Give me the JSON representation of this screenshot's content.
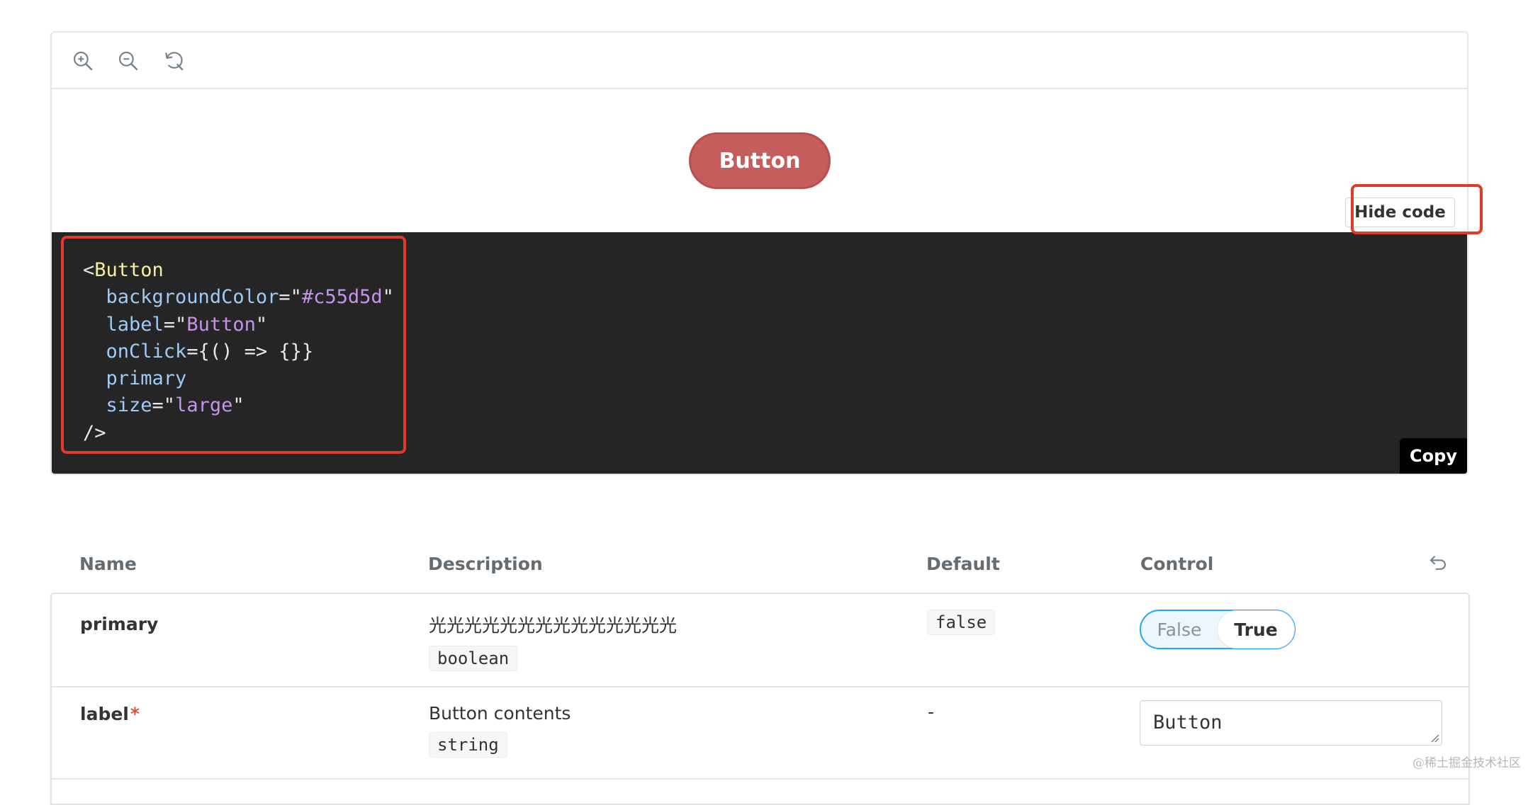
{
  "toolbar": {
    "icons": [
      "zoom-in-icon",
      "zoom-out-icon",
      "reset-zoom-icon"
    ]
  },
  "preview": {
    "button_label": "Button",
    "button_color": "#c55d5d",
    "hide_code_label": "Hide code"
  },
  "code": {
    "lines": [
      {
        "tag": "<Button"
      },
      {
        "attr": "backgroundColor",
        "eq": "=\"",
        "str": "#c55d5d",
        "end": "\""
      },
      {
        "attr": "label",
        "eq": "=\"",
        "str": "Button",
        "end": "\""
      },
      {
        "attr": "onClick",
        "eq": "={() => {}}"
      },
      {
        "attr": "primary"
      },
      {
        "attr": "size",
        "eq": "=\"",
        "str": "large",
        "end": "\""
      },
      {
        "tag": "/>"
      }
    ],
    "copy_label": "Copy"
  },
  "highlight_color": "#e03a2c",
  "table": {
    "headers": {
      "name": "Name",
      "description": "Description",
      "default": "Default",
      "control": "Control"
    },
    "rows": [
      {
        "name": "primary",
        "required": false,
        "description": "光光光光光光光光光光光光光光",
        "type": "boolean",
        "default": "false",
        "control": {
          "type": "toggle",
          "options": [
            "False",
            "True"
          ],
          "selected": "True"
        }
      },
      {
        "name": "label",
        "required": true,
        "required_mark": "*",
        "description": "Button contents",
        "type": "string",
        "default": "-",
        "control": {
          "type": "text",
          "value": "Button"
        }
      }
    ]
  },
  "watermark": "@稀土掘金技术社区"
}
